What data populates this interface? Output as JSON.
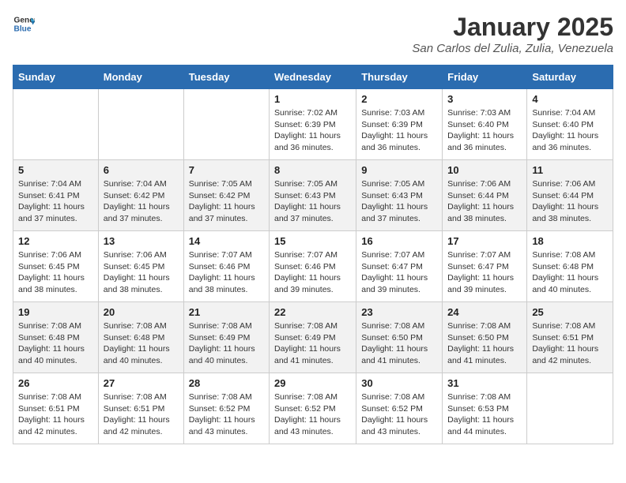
{
  "header": {
    "logo_general": "General",
    "logo_blue": "Blue",
    "title": "January 2025",
    "subtitle": "San Carlos del Zulia, Zulia, Venezuela"
  },
  "weekdays": [
    "Sunday",
    "Monday",
    "Tuesday",
    "Wednesday",
    "Thursday",
    "Friday",
    "Saturday"
  ],
  "weeks": [
    [
      {
        "day": "",
        "info": ""
      },
      {
        "day": "",
        "info": ""
      },
      {
        "day": "",
        "info": ""
      },
      {
        "day": "1",
        "info": "Sunrise: 7:02 AM\nSunset: 6:39 PM\nDaylight: 11 hours and 36 minutes."
      },
      {
        "day": "2",
        "info": "Sunrise: 7:03 AM\nSunset: 6:39 PM\nDaylight: 11 hours and 36 minutes."
      },
      {
        "day": "3",
        "info": "Sunrise: 7:03 AM\nSunset: 6:40 PM\nDaylight: 11 hours and 36 minutes."
      },
      {
        "day": "4",
        "info": "Sunrise: 7:04 AM\nSunset: 6:40 PM\nDaylight: 11 hours and 36 minutes."
      }
    ],
    [
      {
        "day": "5",
        "info": "Sunrise: 7:04 AM\nSunset: 6:41 PM\nDaylight: 11 hours and 37 minutes."
      },
      {
        "day": "6",
        "info": "Sunrise: 7:04 AM\nSunset: 6:42 PM\nDaylight: 11 hours and 37 minutes."
      },
      {
        "day": "7",
        "info": "Sunrise: 7:05 AM\nSunset: 6:42 PM\nDaylight: 11 hours and 37 minutes."
      },
      {
        "day": "8",
        "info": "Sunrise: 7:05 AM\nSunset: 6:43 PM\nDaylight: 11 hours and 37 minutes."
      },
      {
        "day": "9",
        "info": "Sunrise: 7:05 AM\nSunset: 6:43 PM\nDaylight: 11 hours and 37 minutes."
      },
      {
        "day": "10",
        "info": "Sunrise: 7:06 AM\nSunset: 6:44 PM\nDaylight: 11 hours and 38 minutes."
      },
      {
        "day": "11",
        "info": "Sunrise: 7:06 AM\nSunset: 6:44 PM\nDaylight: 11 hours and 38 minutes."
      }
    ],
    [
      {
        "day": "12",
        "info": "Sunrise: 7:06 AM\nSunset: 6:45 PM\nDaylight: 11 hours and 38 minutes."
      },
      {
        "day": "13",
        "info": "Sunrise: 7:06 AM\nSunset: 6:45 PM\nDaylight: 11 hours and 38 minutes."
      },
      {
        "day": "14",
        "info": "Sunrise: 7:07 AM\nSunset: 6:46 PM\nDaylight: 11 hours and 38 minutes."
      },
      {
        "day": "15",
        "info": "Sunrise: 7:07 AM\nSunset: 6:46 PM\nDaylight: 11 hours and 39 minutes."
      },
      {
        "day": "16",
        "info": "Sunrise: 7:07 AM\nSunset: 6:47 PM\nDaylight: 11 hours and 39 minutes."
      },
      {
        "day": "17",
        "info": "Sunrise: 7:07 AM\nSunset: 6:47 PM\nDaylight: 11 hours and 39 minutes."
      },
      {
        "day": "18",
        "info": "Sunrise: 7:08 AM\nSunset: 6:48 PM\nDaylight: 11 hours and 40 minutes."
      }
    ],
    [
      {
        "day": "19",
        "info": "Sunrise: 7:08 AM\nSunset: 6:48 PM\nDaylight: 11 hours and 40 minutes."
      },
      {
        "day": "20",
        "info": "Sunrise: 7:08 AM\nSunset: 6:48 PM\nDaylight: 11 hours and 40 minutes."
      },
      {
        "day": "21",
        "info": "Sunrise: 7:08 AM\nSunset: 6:49 PM\nDaylight: 11 hours and 40 minutes."
      },
      {
        "day": "22",
        "info": "Sunrise: 7:08 AM\nSunset: 6:49 PM\nDaylight: 11 hours and 41 minutes."
      },
      {
        "day": "23",
        "info": "Sunrise: 7:08 AM\nSunset: 6:50 PM\nDaylight: 11 hours and 41 minutes."
      },
      {
        "day": "24",
        "info": "Sunrise: 7:08 AM\nSunset: 6:50 PM\nDaylight: 11 hours and 41 minutes."
      },
      {
        "day": "25",
        "info": "Sunrise: 7:08 AM\nSunset: 6:51 PM\nDaylight: 11 hours and 42 minutes."
      }
    ],
    [
      {
        "day": "26",
        "info": "Sunrise: 7:08 AM\nSunset: 6:51 PM\nDaylight: 11 hours and 42 minutes."
      },
      {
        "day": "27",
        "info": "Sunrise: 7:08 AM\nSunset: 6:51 PM\nDaylight: 11 hours and 42 minutes."
      },
      {
        "day": "28",
        "info": "Sunrise: 7:08 AM\nSunset: 6:52 PM\nDaylight: 11 hours and 43 minutes."
      },
      {
        "day": "29",
        "info": "Sunrise: 7:08 AM\nSunset: 6:52 PM\nDaylight: 11 hours and 43 minutes."
      },
      {
        "day": "30",
        "info": "Sunrise: 7:08 AM\nSunset: 6:52 PM\nDaylight: 11 hours and 43 minutes."
      },
      {
        "day": "31",
        "info": "Sunrise: 7:08 AM\nSunset: 6:53 PM\nDaylight: 11 hours and 44 minutes."
      },
      {
        "day": "",
        "info": ""
      }
    ]
  ]
}
